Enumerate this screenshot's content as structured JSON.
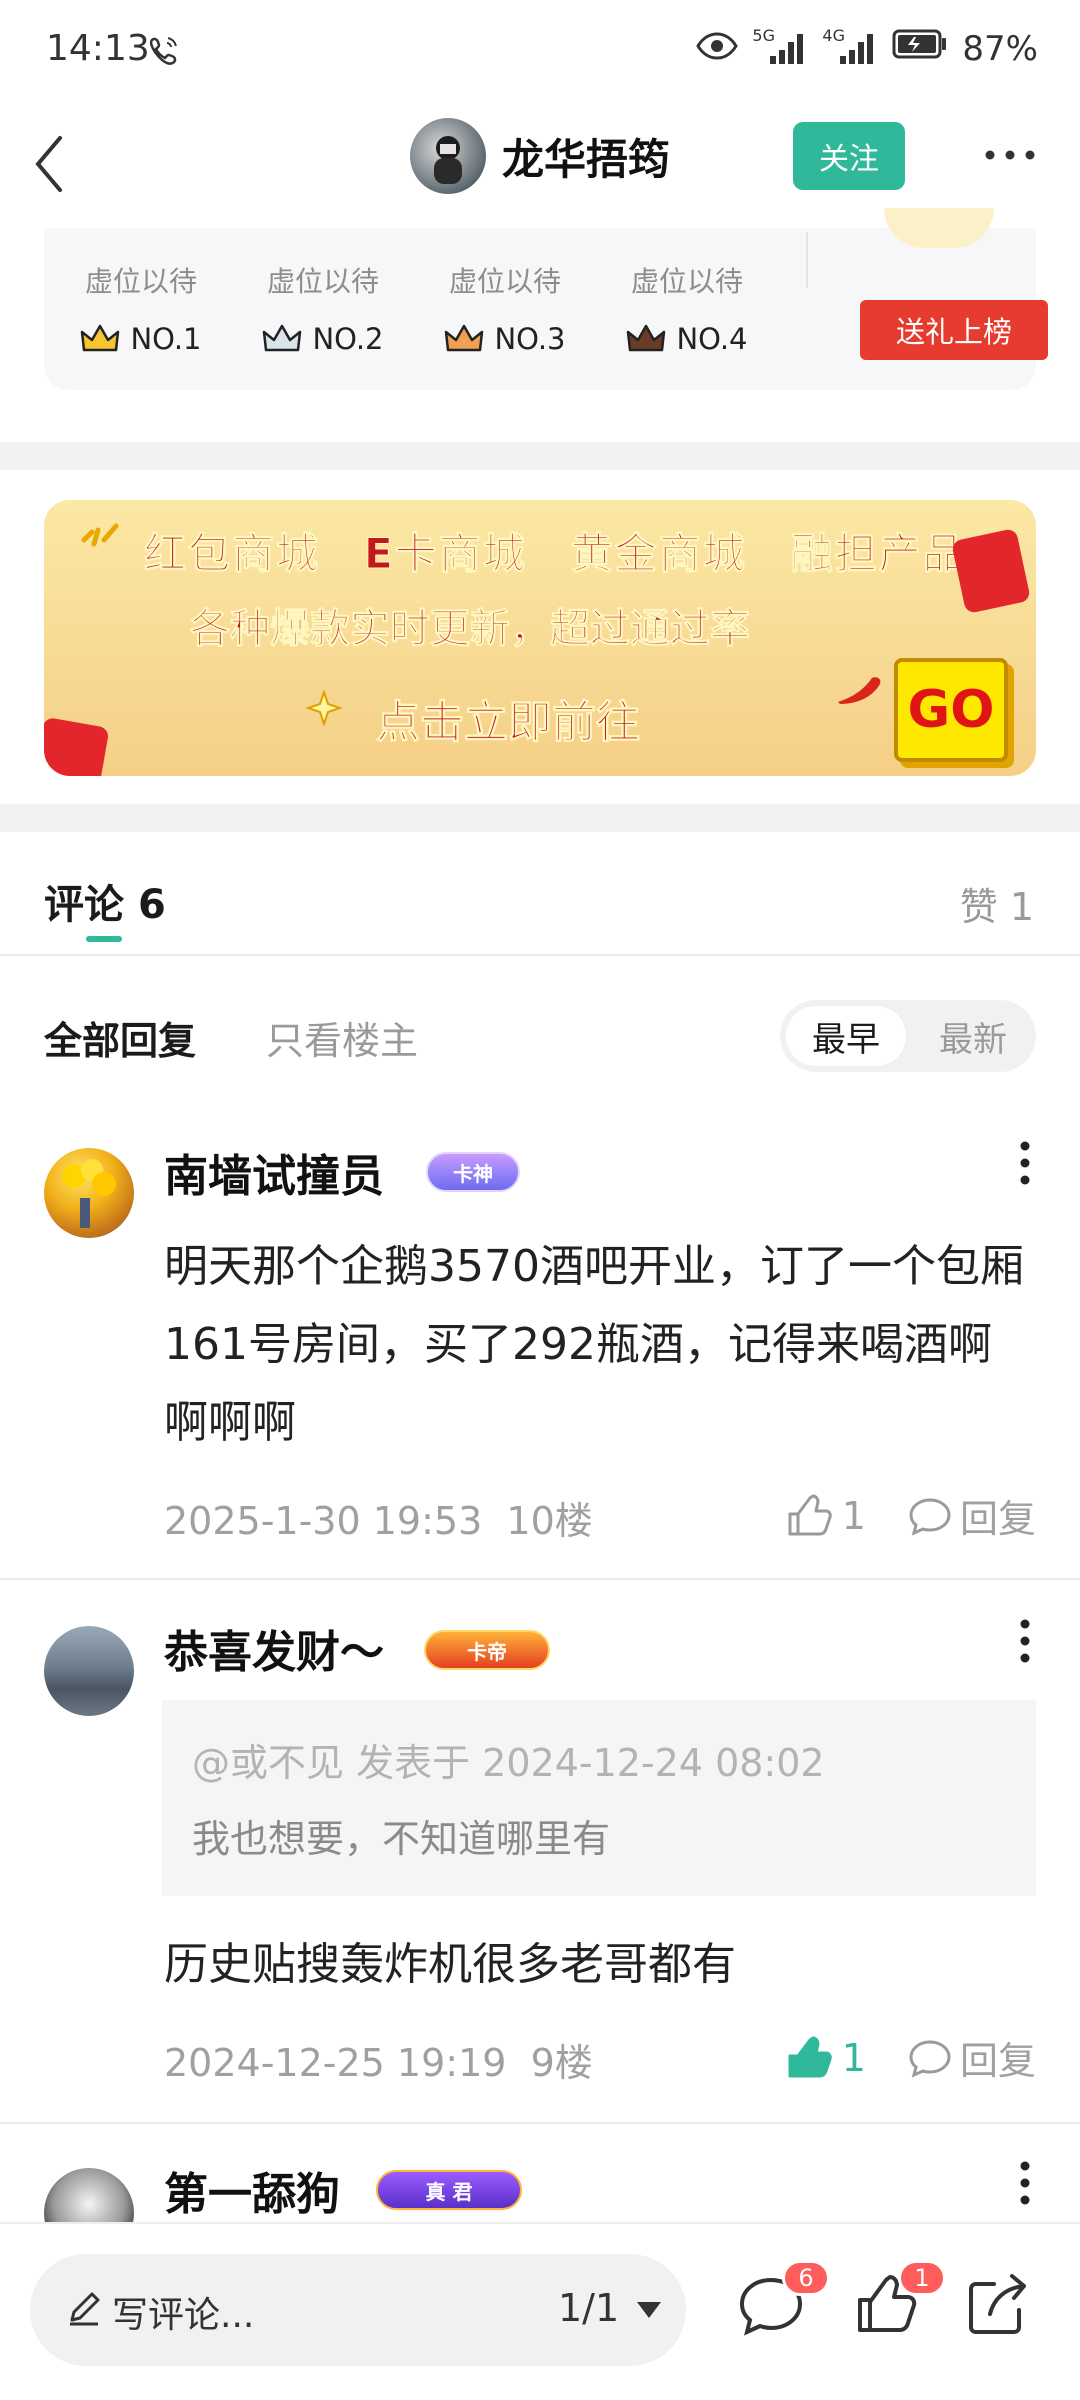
{
  "status_bar": {
    "time": "14:13",
    "network_1": "5G",
    "network_2": "4G",
    "battery": "87%"
  },
  "header": {
    "username": "龙华捂筠",
    "follow_label": "关注"
  },
  "ranking": {
    "slots": [
      {
        "label": "虚位以待",
        "rank": "NO.1"
      },
      {
        "label": "虚位以待",
        "rank": "NO.2"
      },
      {
        "label": "虚位以待",
        "rank": "NO.3"
      },
      {
        "label": "虚位以待",
        "rank": "NO.4"
      }
    ],
    "gift_label": "送礼上榜"
  },
  "banner": {
    "line1": [
      "红包商城",
      "E卡商城",
      "黄金商城",
      "融担产品"
    ],
    "line2": "各种爆款实时更新，超过通过率",
    "line3": "点击立即前往",
    "go_label": "GO"
  },
  "comments_header": {
    "tab_label": "评论",
    "tab_count": "6",
    "likes_label": "赞",
    "likes_count": "1"
  },
  "filter": {
    "all_label": "全部回复",
    "op_only_label": "只看楼主",
    "sort_earliest": "最早",
    "sort_newest": "最新"
  },
  "comments": [
    {
      "name": "南墙试撞员",
      "title_badge": "卡神",
      "text": "明天那个企鹅3570酒吧开业，订了一个包厢161号房间，买了292瓶酒，记得来喝酒啊啊啊啊",
      "date": "2025-1-30 19:53",
      "floor": "10楼",
      "likes": "1",
      "reply_label": "回复"
    },
    {
      "name": "恭喜发财～",
      "title_badge": "卡帝",
      "quote_header": "@或不见 发表于 2024-12-24 08:02",
      "quote_text": "我也想要，不知道哪里有",
      "text": "历史贴搜轰炸机很多老哥都有",
      "date": "2024-12-25 19:19",
      "floor": "9楼",
      "likes": "1",
      "reply_label": "回复"
    },
    {
      "name": "第一舔狗",
      "title_badge": "真 君"
    }
  ],
  "bottom_bar": {
    "comment_placeholder": "写评论...",
    "page_indicator": "1/1",
    "comment_badge": "6",
    "like_badge": "1"
  },
  "colors": {
    "accent_green": "#2fb89a",
    "gift_red": "#e63b2e",
    "badge_red": "#ff5c5c"
  }
}
